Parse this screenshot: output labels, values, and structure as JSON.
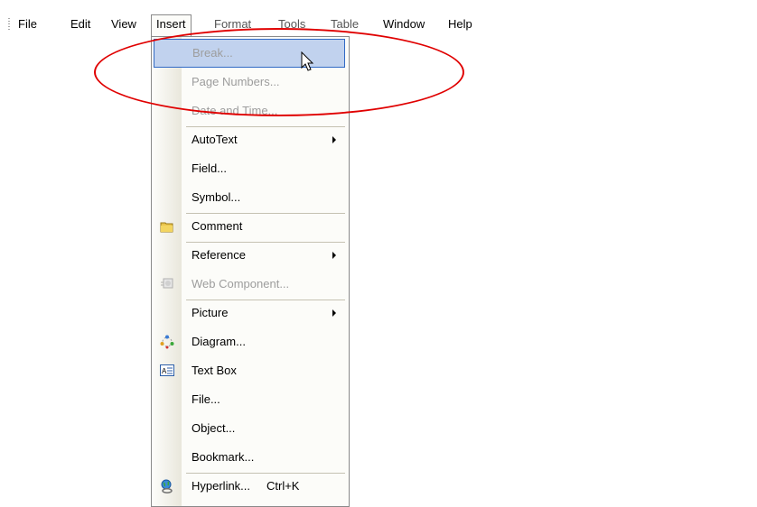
{
  "menubar": {
    "items": [
      {
        "label": "File"
      },
      {
        "label": "Edit"
      },
      {
        "label": "View"
      },
      {
        "label": "Insert"
      },
      {
        "label": "Format"
      },
      {
        "label": "Tools"
      },
      {
        "label": "Table"
      },
      {
        "label": "Window"
      },
      {
        "label": "Help"
      }
    ]
  },
  "insert_menu": {
    "items": [
      {
        "label": "Break...",
        "state": "highlighted-disabled"
      },
      {
        "label": "Page Numbers...",
        "state": "disabled"
      },
      {
        "label": "Date and Time...",
        "state": "disabled"
      },
      {
        "label": "AutoText",
        "submenu": true
      },
      {
        "label": "Field..."
      },
      {
        "label": "Symbol..."
      },
      {
        "label": "Comment",
        "icon": "comment-folder-icon"
      },
      {
        "label": "Reference",
        "submenu": true
      },
      {
        "label": "Web Component...",
        "state": "disabled",
        "icon": "web-component-icon"
      },
      {
        "label": "Picture",
        "submenu": true
      },
      {
        "label": "Diagram...",
        "icon": "diagram-icon"
      },
      {
        "label": "Text Box",
        "icon": "text-box-icon"
      },
      {
        "label": "File..."
      },
      {
        "label": "Object..."
      },
      {
        "label": "Bookmark..."
      },
      {
        "label": "Hyperlink...",
        "shortcut": "Ctrl+K",
        "icon": "hyperlink-globe-icon"
      }
    ]
  },
  "colors": {
    "annotation": "#e00000",
    "highlight": "#c1d2ee",
    "highlight_border": "#316ac5",
    "disabled_text": "#9d9d9d"
  }
}
